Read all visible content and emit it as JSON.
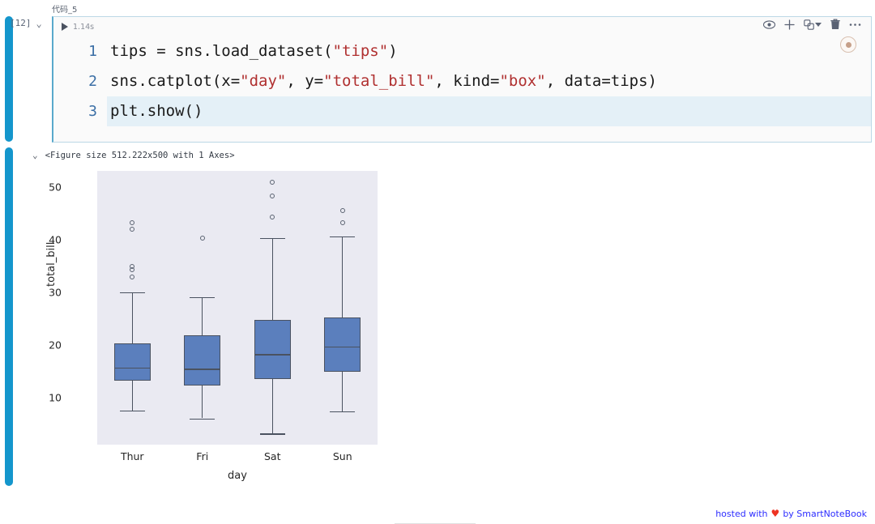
{
  "cell": {
    "name": "代码_5",
    "exec_count": "[12]",
    "collapse_icon": "chevron-down-icon",
    "runtime": "1.14s",
    "run_icon": "play-icon",
    "actions": [
      {
        "name": "eye-icon",
        "glyph": "◉"
      },
      {
        "name": "plus-icon",
        "glyph": "+"
      },
      {
        "name": "split-cell-icon",
        "glyph": "⑃"
      },
      {
        "name": "trash-icon",
        "glyph": "🗑"
      },
      {
        "name": "more-icon",
        "glyph": "⋯"
      }
    ],
    "kernel_badge": "python-kernel-icon"
  },
  "code": {
    "lines": [
      {
        "number": "1",
        "active": false,
        "tokens": [
          {
            "t": "tips = sns.load_dataset(",
            "c": "plain"
          },
          {
            "t": "\"tips\"",
            "c": "str"
          },
          {
            "t": ")",
            "c": "plain"
          }
        ]
      },
      {
        "number": "2",
        "active": false,
        "tokens": [
          {
            "t": "sns.catplot(x=",
            "c": "plain"
          },
          {
            "t": "\"day\"",
            "c": "str"
          },
          {
            "t": ", y=",
            "c": "plain"
          },
          {
            "t": "\"total_bill\"",
            "c": "str"
          },
          {
            "t": ", kind=",
            "c": "plain"
          },
          {
            "t": "\"box\"",
            "c": "str"
          },
          {
            "t": ", data=tips)",
            "c": "plain"
          }
        ]
      },
      {
        "number": "3",
        "active": true,
        "tokens": [
          {
            "t": "plt.show()",
            "c": "plain"
          }
        ]
      }
    ]
  },
  "output": {
    "collapse_icon": "chevron-down-icon",
    "repr_text": "<Figure size 512.222x500 with 1 Axes>"
  },
  "footer": {
    "prefix": "hosted with",
    "heart": "♥",
    "suffix": "by SmartNoteBook"
  },
  "colors": {
    "accent": "#1496cc",
    "box_fill": "#5b7fbd",
    "box_line": "#4a5260",
    "plot_bg": "#eaeaf2",
    "string_token": "#b03030",
    "line_number": "#3a6ea5",
    "active_line_bg": "#e4f0f7",
    "footer_link": "#2c2cff",
    "heart": "#ee3322"
  },
  "chart_data": {
    "type": "box",
    "title": "",
    "xlabel": "day",
    "ylabel": "total_bill",
    "categories": [
      "Thur",
      "Fri",
      "Sat",
      "Sun"
    ],
    "ylim": [
      1,
      53
    ],
    "yticks": [
      10,
      20,
      30,
      40,
      50
    ],
    "grid": false,
    "legend": "none",
    "boxes": [
      {
        "category": "Thur",
        "whisker_low": 7.5,
        "q1": 13.2,
        "median": 15.6,
        "q3": 20.3,
        "whisker_high": 30.0,
        "outliers": [
          32.9,
          34.3,
          34.8,
          41.9,
          43.2
        ]
      },
      {
        "category": "Fri",
        "whisker_low": 6.0,
        "q1": 12.2,
        "median": 15.4,
        "q3": 21.7,
        "whisker_high": 29.0,
        "outliers": [
          40.3
        ]
      },
      {
        "category": "Sat",
        "whisker_low": 3.1,
        "q1": 13.4,
        "median": 18.2,
        "q3": 24.7,
        "whisker_high": 40.2,
        "outliers": [
          44.3,
          48.3,
          50.8
        ]
      },
      {
        "category": "Sun",
        "whisker_low": 7.3,
        "q1": 14.8,
        "median": 19.6,
        "q3": 25.1,
        "whisker_high": 40.6,
        "outliers": [
          43.1,
          45.4
        ]
      }
    ]
  }
}
